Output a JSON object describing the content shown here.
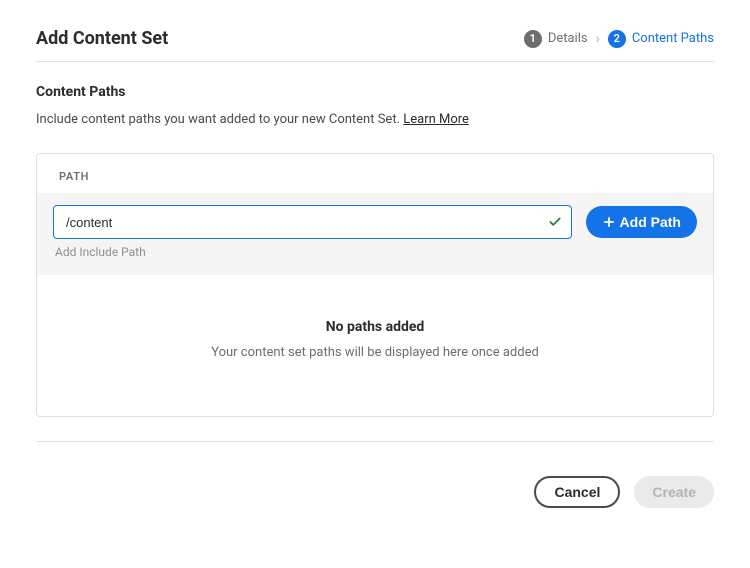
{
  "header": {
    "title": "Add Content Set"
  },
  "stepper": {
    "steps": [
      {
        "num": "1",
        "label": "Details",
        "active": false
      },
      {
        "num": "2",
        "label": "Content Paths",
        "active": true
      }
    ]
  },
  "section": {
    "title": "Content Paths",
    "description": "Include content paths you want added to your new Content Set. ",
    "learn_more": "Learn More"
  },
  "table": {
    "column_header": "PATH",
    "input_value": "/content",
    "input_hint": "Add Include Path",
    "add_button_label": "Add Path"
  },
  "empty": {
    "title": "No paths added",
    "subtitle": "Your content set paths will be displayed here once added"
  },
  "footer": {
    "cancel": "Cancel",
    "create": "Create"
  }
}
